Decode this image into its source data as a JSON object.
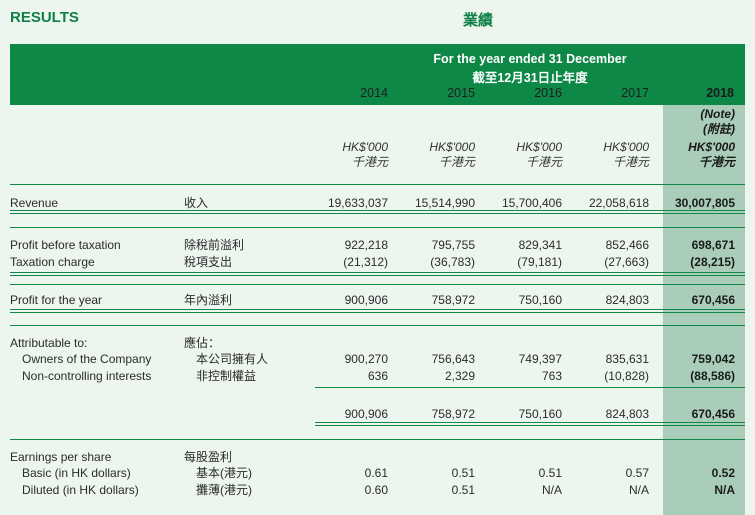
{
  "header": {
    "title_en": "RESULTS",
    "title_zh": "業績"
  },
  "table_header": {
    "period_en": "For the year ended 31 December",
    "period_zh": "截至12月31日止年度",
    "years": [
      "2014",
      "2015",
      "2016",
      "2017",
      "2018"
    ],
    "note_2018": [
      "(Note)",
      "(附註)"
    ],
    "unit_en": "HK$'000",
    "unit_zh": "千港元"
  },
  "rows": {
    "revenue": {
      "en": "Revenue",
      "zh": "收入",
      "values": [
        "19,633,037",
        "15,514,990",
        "15,700,406",
        "22,058,618",
        "30,007,805"
      ]
    },
    "profit_before_tax": {
      "en": "Profit before taxation",
      "zh": "除稅前溢利",
      "values": [
        "922,218",
        "795,755",
        "829,341",
        "852,466",
        "698,671"
      ]
    },
    "taxation": {
      "en": "Taxation charge",
      "zh": "稅項支出",
      "values": [
        "(21,312)",
        "(36,783)",
        "(79,181)",
        "(27,663)",
        "(28,215)"
      ]
    },
    "profit_year": {
      "en": "Profit for the year",
      "zh": "年內溢利",
      "values": [
        "900,906",
        "758,972",
        "750,160",
        "824,803",
        "670,456"
      ]
    },
    "attributable": {
      "en": "Attributable to:",
      "zh": "應佔："
    },
    "owners": {
      "en": "Owners of the Company",
      "zh": "本公司擁有人",
      "values": [
        "900,270",
        "756,643",
        "749,397",
        "835,631",
        "759,042"
      ]
    },
    "nci": {
      "en": "Non-controlling interests",
      "zh": "非控制權益",
      "values": [
        "636",
        "2,329",
        "763",
        "(10,828)",
        "(88,586)"
      ]
    },
    "total": {
      "values": [
        "900,906",
        "758,972",
        "750,160",
        "824,803",
        "670,456"
      ]
    },
    "eps": {
      "en": "Earnings per share",
      "zh": "每股盈利"
    },
    "basic": {
      "en": "Basic (in HK dollars)",
      "zh": "基本(港元)",
      "values": [
        "0.61",
        "0.51",
        "0.51",
        "0.57",
        "0.52"
      ]
    },
    "diluted": {
      "en": "Diluted (in HK dollars)",
      "zh": "攤薄(港元)",
      "values": [
        "0.60",
        "0.51",
        "N/A",
        "N/A",
        "N/A"
      ]
    }
  }
}
